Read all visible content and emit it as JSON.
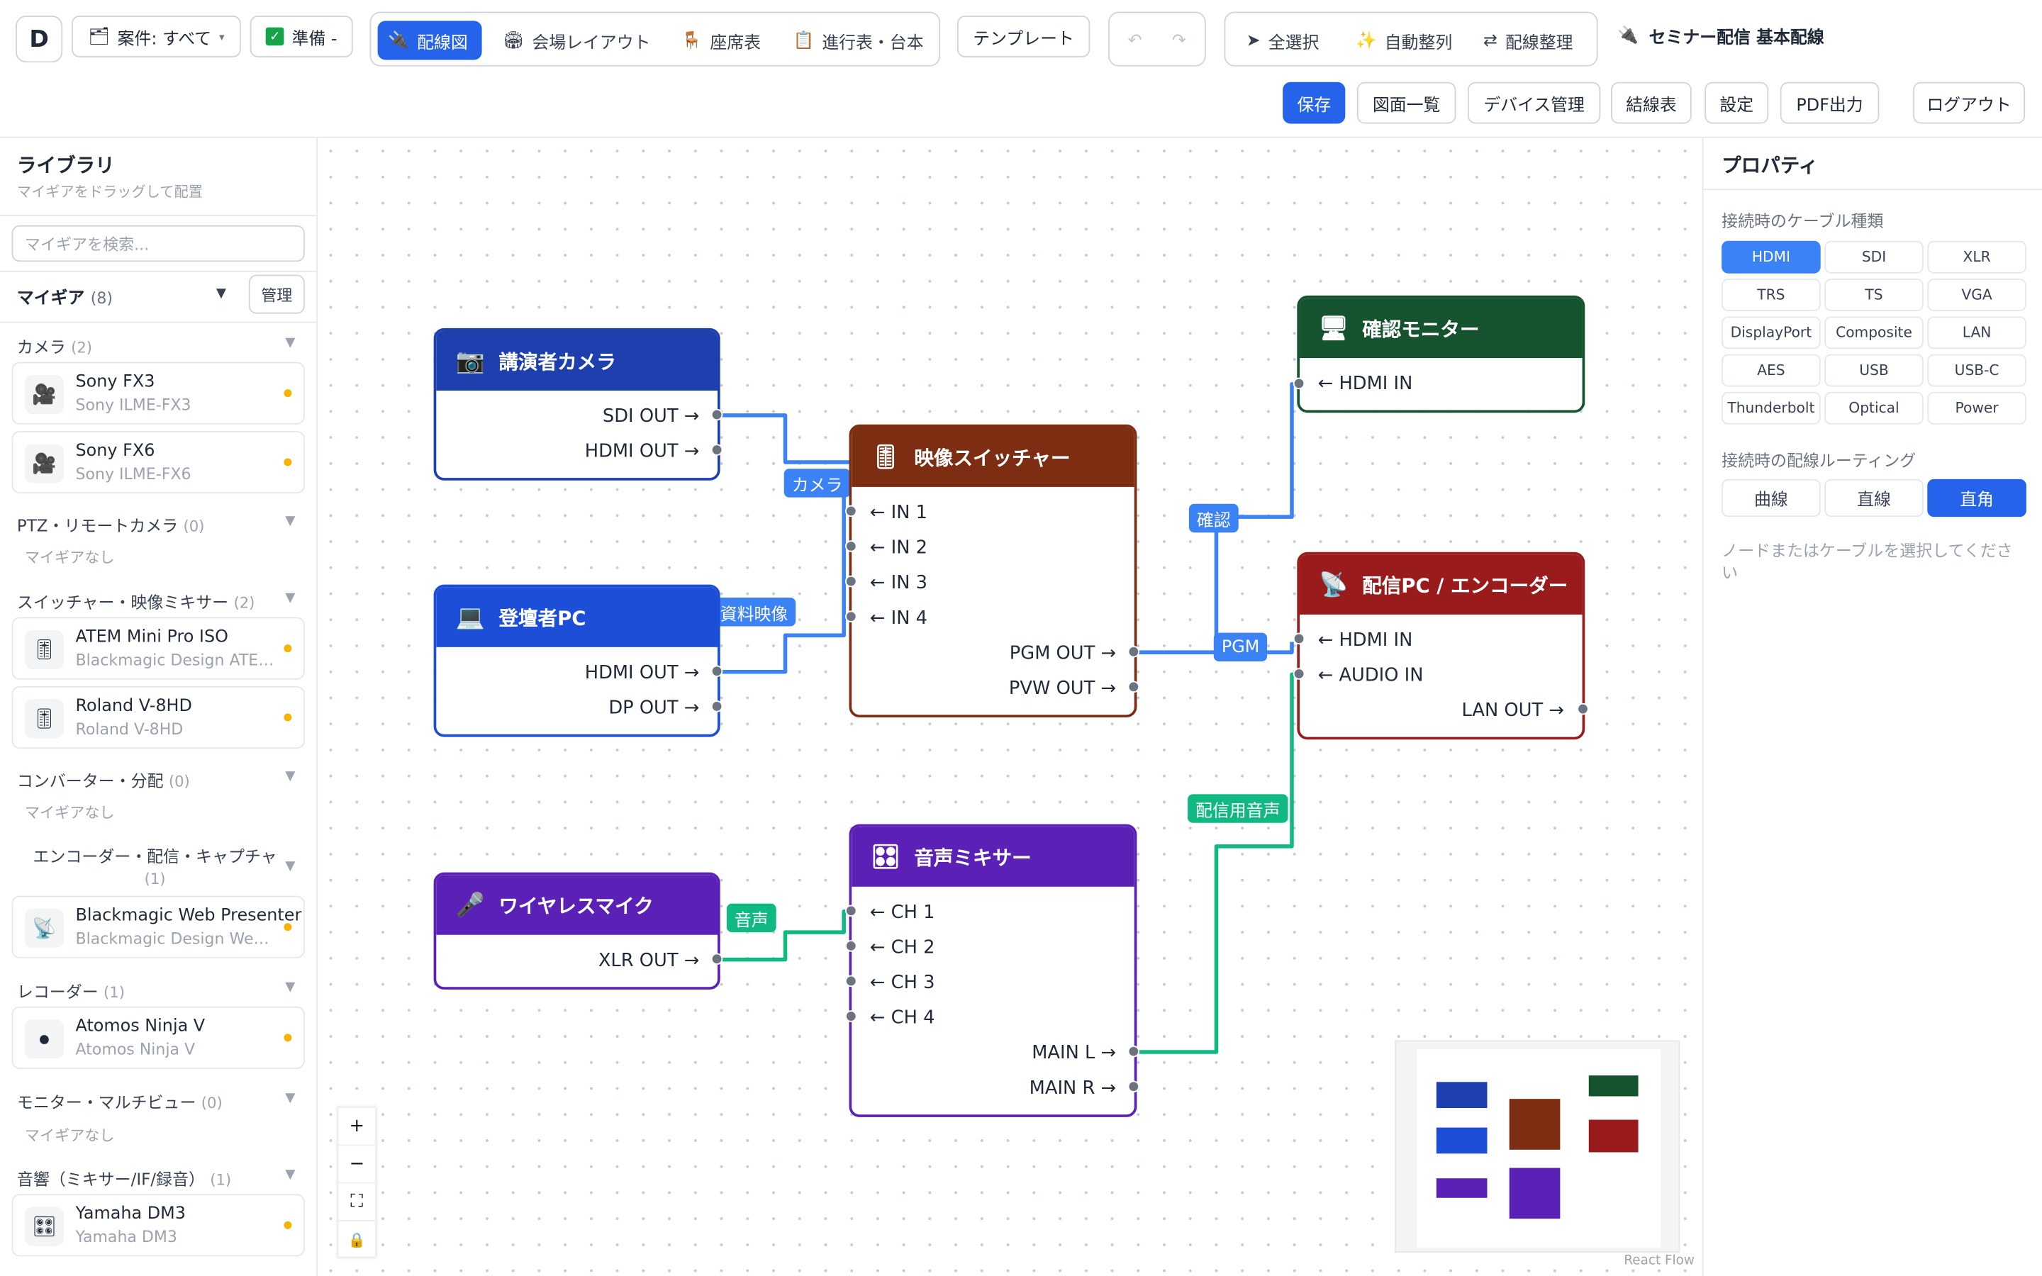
{
  "topbar": {
    "logo": "D",
    "project_filter": "案件: すべて",
    "status": "準備 -",
    "views": [
      {
        "label": "配線図",
        "icon": "plug-icon"
      },
      {
        "label": "会場レイアウト",
        "icon": "venue-icon"
      },
      {
        "label": "座席表",
        "icon": "chair-icon"
      },
      {
        "label": "進行表・台本",
        "icon": "document-icon"
      }
    ],
    "template": "テンプレート",
    "undo": "↶",
    "redo": "↷",
    "select_all": "全選択",
    "auto_align": "自動整列",
    "organize": "配線整理",
    "title": "セミナー配信 基本配線",
    "save": "保存",
    "drawings": "図面一覧",
    "devices": "デバイス管理",
    "wiring_table": "結線表",
    "settings": "設定",
    "pdf": "PDF出力",
    "logout": "ログアウト"
  },
  "library": {
    "title": "ライブラリ",
    "subtitle": "マイギアをドラッグして配置",
    "search_placeholder": "マイギアを検索...",
    "my_gear": "マイギア",
    "my_gear_count": "(8)",
    "manage": "管理",
    "categories": [
      {
        "name": "カメラ",
        "count": "(2)",
        "items": [
          {
            "name": "Sony FX3",
            "model": "Sony ILME-FX3"
          },
          {
            "name": "Sony FX6",
            "model": "Sony ILME-FX6"
          }
        ]
      },
      {
        "name": "PTZ・リモートカメラ",
        "count": "(0)",
        "empty": "マイギアなし"
      },
      {
        "name": "スイッチャー・映像ミキサー",
        "count": "(2)",
        "items": [
          {
            "name": "ATEM Mini Pro ISO",
            "model": "Blackmagic Design ATEM Mini Pro ISO"
          },
          {
            "name": "Roland V-8HD",
            "model": "Roland V-8HD"
          }
        ]
      },
      {
        "name": "コンバーター・分配",
        "count": "(0)",
        "empty": "マイギアなし"
      },
      {
        "name": "エンコーダー・配信・キャプチャ",
        "count": "(1)",
        "items": [
          {
            "name": "Blackmagic Web Presenter",
            "model": "Blackmagic Design Web Presenter"
          }
        ]
      },
      {
        "name": "レコーダー",
        "count": "(1)",
        "items": [
          {
            "name": "Atomos Ninja V",
            "model": "Atomos Ninja V"
          }
        ]
      },
      {
        "name": "モニター・マルチビュー",
        "count": "(0)",
        "empty": "マイギアなし"
      },
      {
        "name": "音響（ミキサー/IF/録音）",
        "count": "(1)",
        "items": [
          {
            "name": "Yamaha DM3",
            "model": "Yamaha DM3"
          }
        ]
      }
    ]
  },
  "properties": {
    "title": "プロパティ",
    "cable_type_label": "接続時のケーブル種類",
    "cable_types": [
      "HDMI",
      "SDI",
      "XLR",
      "TRS",
      "TS",
      "VGA",
      "DisplayPort",
      "Composite",
      "LAN",
      "AES",
      "USB",
      "USB-C",
      "Thunderbolt",
      "Optical",
      "Power"
    ],
    "cable_selected": "HDMI",
    "routing_label": "接続時の配線ルーティング",
    "routings": [
      "曲線",
      "直線",
      "直角"
    ],
    "routing_selected": "直角",
    "hint": "ノードまたはケーブルを選択してください"
  },
  "nodes": {
    "cam": {
      "title": "講演者カメラ",
      "color": "#1e40af",
      "outs": [
        "SDI OUT →",
        "HDMI OUT →"
      ]
    },
    "pc": {
      "title": "登壇者PC",
      "color": "#1d4ed8",
      "outs": [
        "HDMI OUT →",
        "DP OUT →"
      ]
    },
    "mic": {
      "title": "ワイヤレスマイク",
      "color": "#5b21b6",
      "outs": [
        "XLR OUT →"
      ]
    },
    "sw": {
      "title": "映像スイッチャー",
      "color": "#7c2d12",
      "ins": [
        "← IN 1",
        "← IN 2",
        "← IN 3",
        "← IN 4"
      ],
      "outs": [
        "PGM OUT →",
        "PVW OUT →"
      ]
    },
    "mx": {
      "title": "音声ミキサー",
      "color": "#5b21b6",
      "ins": [
        "← CH 1",
        "← CH 2",
        "← CH 3",
        "← CH 4"
      ],
      "outs": [
        "MAIN L →",
        "MAIN R →"
      ]
    },
    "mon": {
      "title": "確認モニター",
      "color": "#14532d",
      "ins": [
        "← HDMI IN"
      ]
    },
    "enc": {
      "title": "配信PC / エンコーダー",
      "color": "#991b1b",
      "ins": [
        "← HDMI IN",
        "← AUDIO IN"
      ],
      "outs": [
        "LAN OUT →"
      ]
    }
  },
  "edges": {
    "camera": "カメラ",
    "slides": "資料映像",
    "confirm": "確認",
    "pgm": "PGM",
    "stream_audio": "配信用音声",
    "audio": "音声"
  },
  "colors": {
    "video_cable": "#3b82f6",
    "audio_cable": "#10b981",
    "accent": "#2563eb"
  },
  "canvas": {
    "zoom_in": "+",
    "zoom_out": "−",
    "fit": "⛶",
    "lock": "🔒",
    "attribution": "React Flow"
  }
}
